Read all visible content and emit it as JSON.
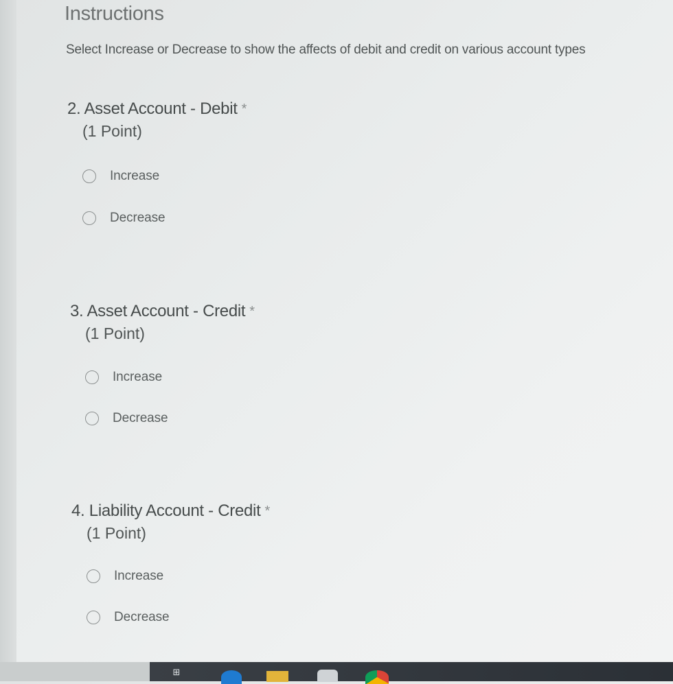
{
  "form": {
    "section_title": "Instructions",
    "instructions": "Select Increase or Decrease to show the affects of debit and credit on various account types",
    "required_marker": "*",
    "questions": [
      {
        "title": "2. Asset Account - Debit",
        "points": "(1 Point)",
        "options": [
          "Increase",
          "Decrease"
        ],
        "selected": null
      },
      {
        "title": "3. Asset Account - Credit",
        "points": "(1 Point)",
        "options": [
          "Increase",
          "Decrease"
        ],
        "selected": null
      },
      {
        "title": "4. Liability Account - Credit",
        "points": "(1 Point)",
        "options": [
          "Increase",
          "Decrease"
        ],
        "selected": null
      }
    ]
  },
  "taskbar": {
    "task_view_icon": "task-view-icon",
    "task_view_glyph": "⊞",
    "apps": [
      "edge-icon",
      "file-explorer-icon",
      "store-icon",
      "chrome-icon"
    ]
  },
  "colors": {
    "background": "#eceeee",
    "text": "#4f5454",
    "radio_border": "#8c9090",
    "taskbar": "#2b3036"
  }
}
